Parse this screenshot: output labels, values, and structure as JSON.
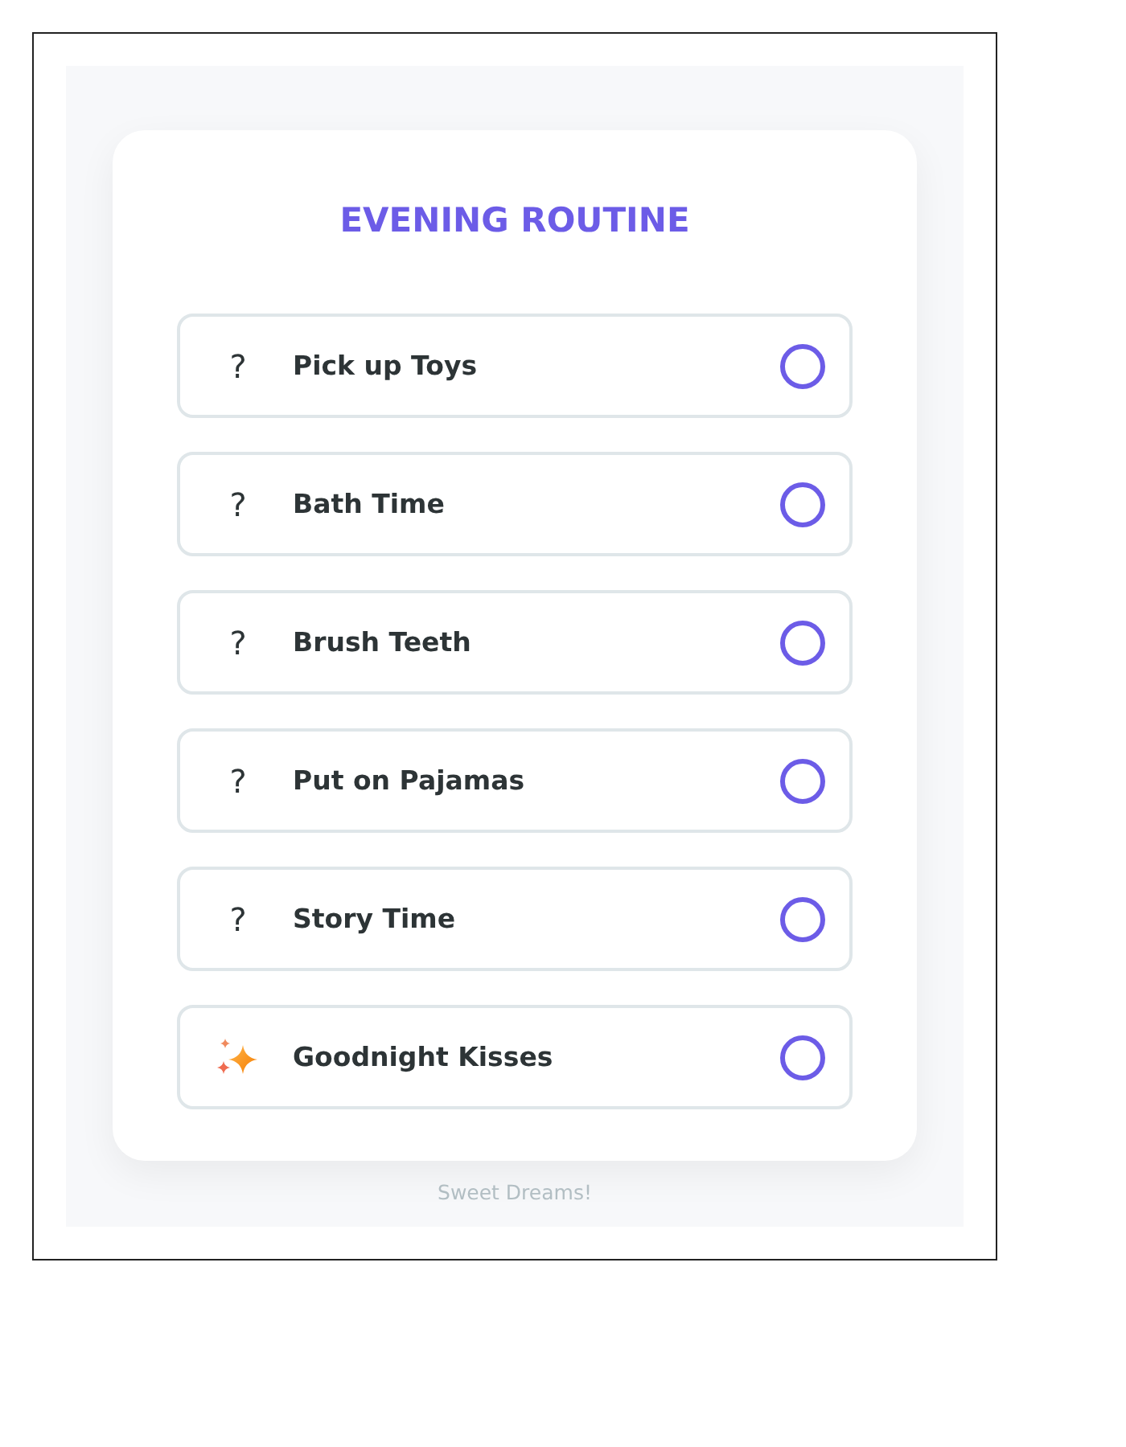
{
  "title": "EVENING ROUTINE",
  "tasks": [
    {
      "kind": "glyph",
      "icon": "?",
      "label": "Pick up Toys",
      "checked": false
    },
    {
      "kind": "glyph",
      "icon": "?",
      "label": "Bath Time",
      "checked": false
    },
    {
      "kind": "glyph",
      "icon": "?",
      "label": "Brush Teeth",
      "checked": false
    },
    {
      "kind": "glyph",
      "icon": "?",
      "label": "Put on Pajamas",
      "checked": false
    },
    {
      "kind": "glyph",
      "icon": "?",
      "label": "Story Time",
      "checked": false
    },
    {
      "kind": "sparkles",
      "label": "Goodnight Kisses",
      "checked": false
    }
  ],
  "footer": "Sweet Dreams!"
}
